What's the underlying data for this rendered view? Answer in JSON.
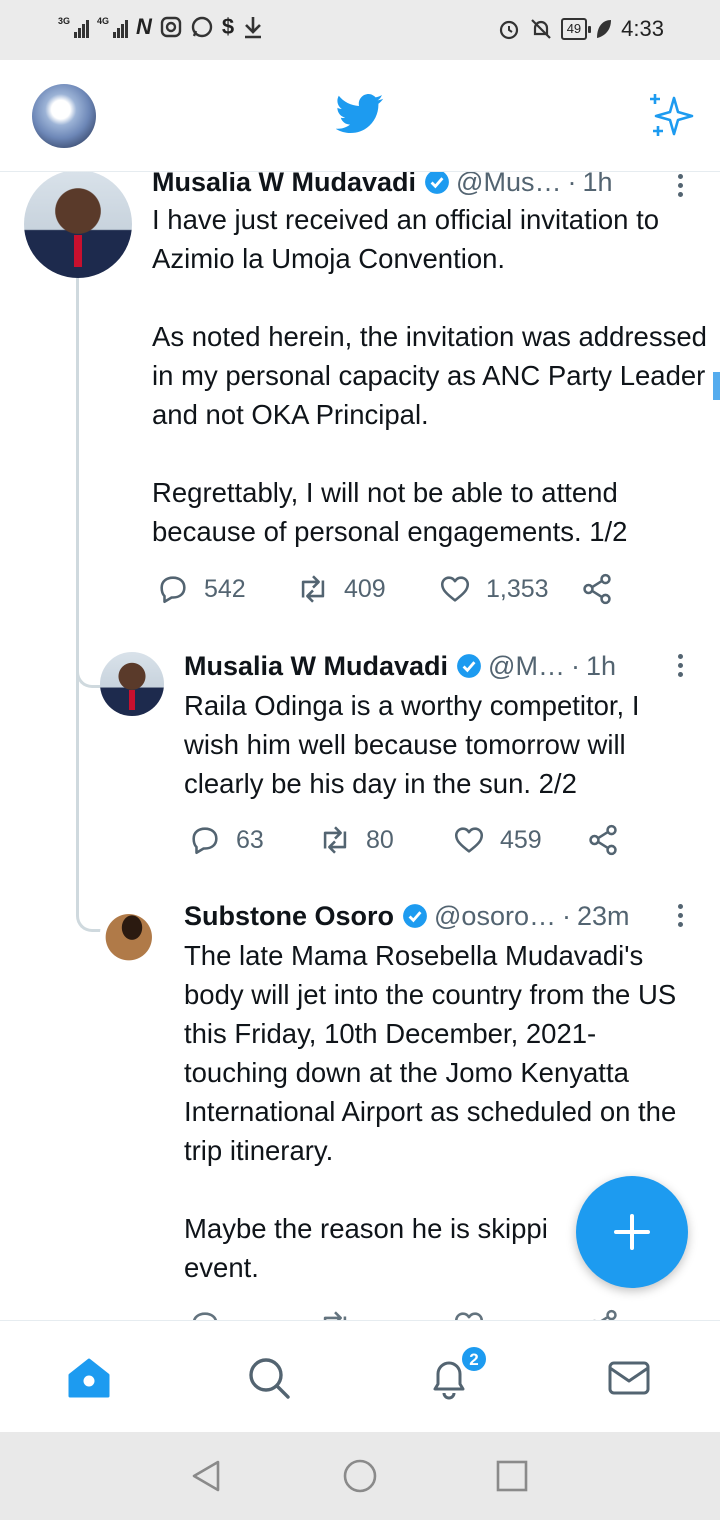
{
  "status_bar": {
    "network_1": "3G",
    "network_2": "4G",
    "battery": "49",
    "time": "4:33",
    "icons": [
      "signal-icon",
      "n-app-icon",
      "instagram-icon",
      "whatsapp-icon",
      "s-app-icon",
      "download-icon",
      "alarm-icon",
      "mute-icon",
      "battery-icon",
      "leaf-icon"
    ]
  },
  "top_bar": {
    "logo": "twitter-bird-icon",
    "sparkle": "sparkle-icon"
  },
  "tweets": [
    {
      "name": "Musalia W Mudavadi",
      "handle": "@Mus…",
      "time": "1h",
      "text": "I have just received an official invitation to Azimio la Umoja Convention.\n\nAs noted herein, the invitation was addressed in my personal capacity as ANC Party Leader and not OKA Principal.\n\nRegrettably, I will not be able to attend because of personal engagements. 1/2",
      "replies": "542",
      "retweets": "409",
      "likes": "1,353"
    },
    {
      "name": "Musalia W Mudavadi",
      "handle": "@M…",
      "time": "1h",
      "text": "Raila Odinga is a worthy competitor, I wish him well because tomorrow will clearly be his day in the sun. 2/2",
      "replies": "63",
      "retweets": "80",
      "likes": "459"
    },
    {
      "name": "Substone Osoro",
      "handle": "@osoro…",
      "time": "23m",
      "text": "The late Mama Rosebella Mudavadi's body will jet into the country from the US this Friday, 10th December, 2021- touching down at the Jomo Kenyatta International Airport as scheduled on the trip itinerary.\n\nMaybe the reason he is skippi\nevent."
    }
  ],
  "bottom_nav": {
    "notifications_badge": "2",
    "items": [
      "home-icon",
      "search-icon",
      "notifications-icon",
      "messages-icon"
    ]
  },
  "colors": {
    "accent": "#1d9bf0",
    "text": "#0f1419",
    "secondary": "#536471"
  }
}
